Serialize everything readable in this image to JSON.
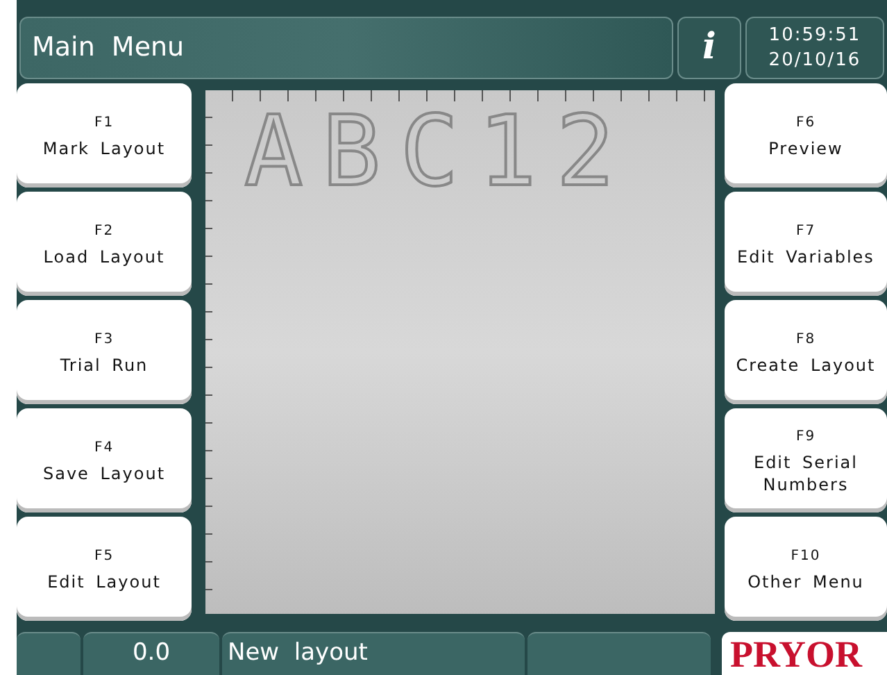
{
  "header": {
    "title": "Main  Menu",
    "info": "i",
    "time": "10:59:51",
    "date": "20/10/16"
  },
  "left_buttons": [
    {
      "key": "F1",
      "label": "Mark Layout"
    },
    {
      "key": "F2",
      "label": "Load Layout"
    },
    {
      "key": "F3",
      "label": "Trial Run"
    },
    {
      "key": "F4",
      "label": "Save Layout"
    },
    {
      "key": "F5",
      "label": "Edit Layout"
    }
  ],
  "right_buttons": [
    {
      "key": "F6",
      "label": "Preview"
    },
    {
      "key": "F7",
      "label": "Edit Variables"
    },
    {
      "key": "F8",
      "label": "Create Layout"
    },
    {
      "key": "F9",
      "label": "Edit Serial Numbers"
    },
    {
      "key": "F10",
      "label": "Other Menu"
    }
  ],
  "preview": {
    "marking": "ABC12"
  },
  "status_bar": {
    "field_1": "0.0",
    "field_2": "New  layout",
    "logo": "PRYOR"
  }
}
